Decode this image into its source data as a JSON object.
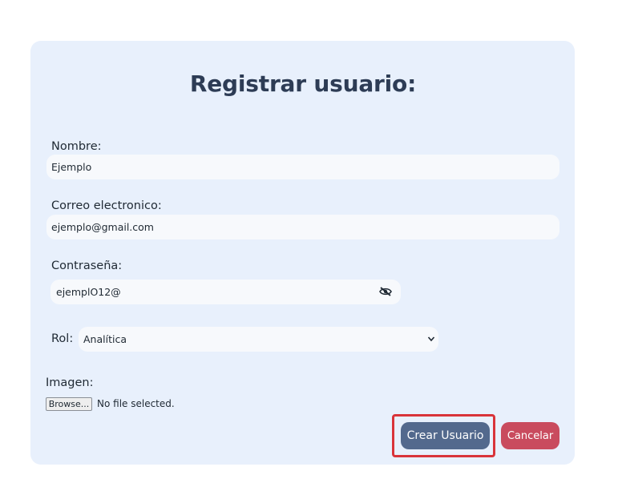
{
  "form": {
    "title": "Registrar usuario:",
    "fields": {
      "name": {
        "label": "Nombre:",
        "value": "Ejemplo"
      },
      "email": {
        "label": "Correo electronico:",
        "value": "ejemplo@gmail.com"
      },
      "password": {
        "label": "Contraseña:",
        "value": "ejemplO12@",
        "toggle_icon": "eye-slash-icon"
      },
      "role": {
        "label": "Rol:",
        "selected": "Analítica",
        "icon": "chevron-down-icon"
      },
      "image": {
        "label": "Imagen:",
        "browse_label": "Browse...",
        "status": "No file selected."
      }
    },
    "buttons": {
      "create": "Crear Usuario",
      "cancel": "Cancelar"
    }
  },
  "colors": {
    "card_background": "#e8f0fc",
    "title": "#2d3c55",
    "create_button": "#53698d",
    "cancel_button": "#c94b5e",
    "highlight": "#d9343a"
  }
}
